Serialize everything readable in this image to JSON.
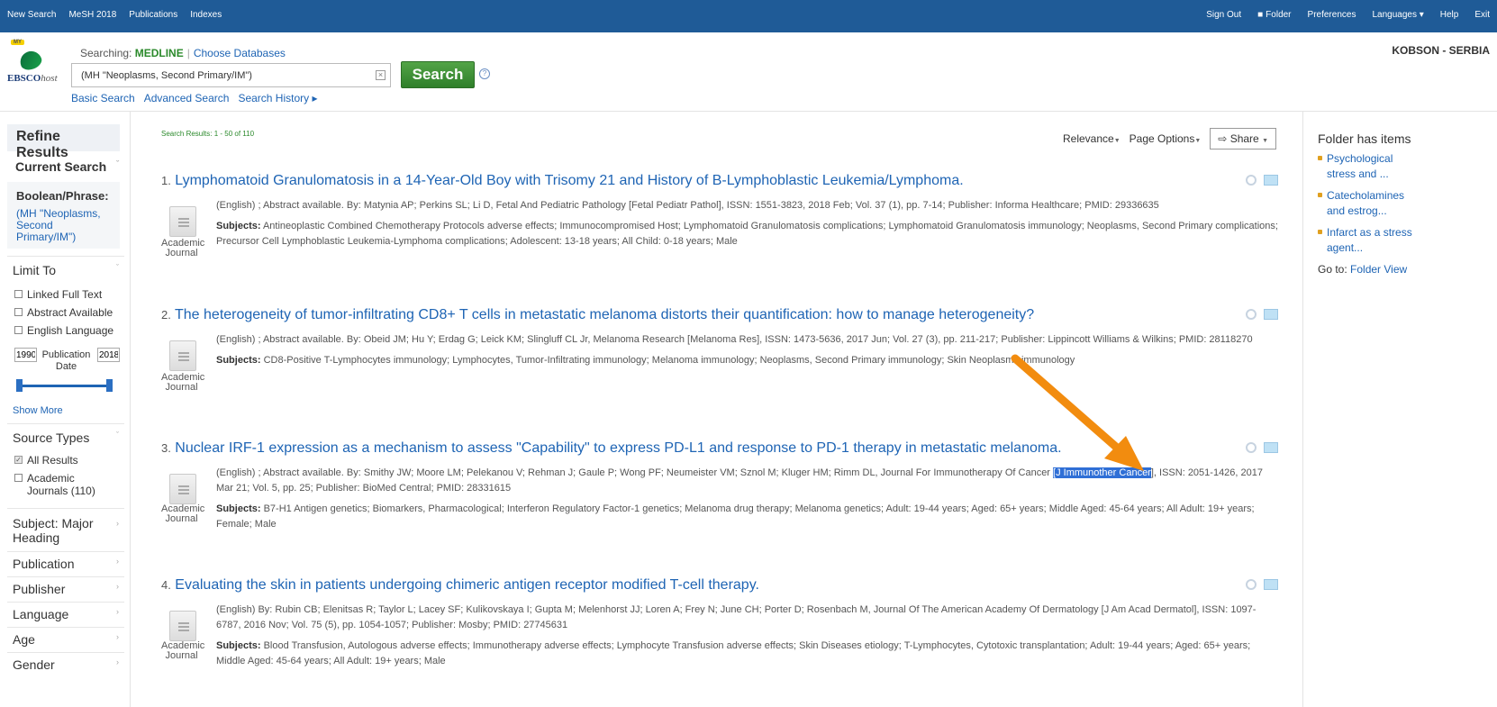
{
  "topnav": {
    "left": [
      "New Search",
      "MeSH 2018",
      "Publications",
      "Indexes"
    ],
    "right": [
      "Sign Out",
      "Folder",
      "Preferences",
      "Languages ▾",
      "Help",
      "Exit"
    ]
  },
  "header": {
    "logo_tag": "MY",
    "logo_brand": "EBSCO",
    "logo_host": "host",
    "searching_label": "Searching:",
    "database": "MEDLINE",
    "choose_databases": "Choose Databases",
    "query": "(MH \"Neoplasms, Second Primary/IM\")",
    "search_button": "Search",
    "links": [
      "Basic Search",
      "Advanced Search",
      "Search History ▸"
    ],
    "organization": "KOBSON - SERBIA"
  },
  "sidebar": {
    "title": "Refine Results",
    "current_search": "Current Search",
    "boolean_label": "Boolean/Phrase:",
    "boolean_value": "(MH \"Neoplasms, Second Primary/IM\")",
    "limit_to": "Limit To",
    "limits": [
      "Linked Full Text",
      "Abstract Available",
      "English Language"
    ],
    "year_from": "1990",
    "year_to": "2018",
    "publication_date": "Publication Date",
    "show_more": "Show More",
    "source_types": "Source Types",
    "source_all": "All Results",
    "source_academic": "Academic Journals (110)",
    "facets": [
      "Subject: Major Heading",
      "Publication",
      "Publisher",
      "Language",
      "Age",
      "Gender"
    ]
  },
  "results": {
    "count": "Search Results: 1 - 50 of 110",
    "sort": "Relevance",
    "page_options": "Page Options",
    "share": "Share",
    "pubtype": "Academic Journal",
    "subjects_label": "Subjects:",
    "items": [
      {
        "num": "1.",
        "title": "Lymphomatoid Granulomatosis in a 14-Year-Old Boy with Trisomy 21 and History of B-Lymphoblastic Leukemia/Lymphoma.",
        "meta": "(English) ; Abstract available. By: Matynia AP; Perkins SL; Li D, Fetal And Pediatric Pathology [Fetal Pediatr Pathol], ISSN: 1551-3823, 2018 Feb; Vol. 37 (1), pp. 7-14; Publisher: Informa Healthcare; PMID: 29336635",
        "subjects": "Antineoplastic Combined Chemotherapy Protocols adverse effects; Immunocompromised Host; Lymphomatoid Granulomatosis complications; Lymphomatoid Granulomatosis immunology; Neoplasms, Second Primary complications; Precursor Cell Lymphoblastic Leukemia-Lymphoma complications; Adolescent: 13-18 years; All Child: 0-18 years; Male"
      },
      {
        "num": "2.",
        "title": "The heterogeneity of tumor-infiltrating CD8+ T cells in metastatic melanoma distorts their quantification: how to manage heterogeneity?",
        "meta": "(English) ; Abstract available. By: Obeid JM; Hu Y; Erdag G; Leick KM; Slingluff CL Jr, Melanoma Research [Melanoma Res], ISSN: 1473-5636, 2017 Jun; Vol. 27 (3), pp. 211-217; Publisher: Lippincott Williams & Wilkins; PMID: 28118270",
        "subjects": "CD8-Positive T-Lymphocytes immunology; Lymphocytes, Tumor-Infiltrating immunology; Melanoma immunology; Neoplasms, Second Primary immunology; Skin Neoplasms immunology"
      },
      {
        "num": "3.",
        "title": "Nuclear IRF-1 expression as a mechanism to assess \"Capability\" to express PD-L1 and response to PD-1 therapy in metastatic melanoma.",
        "meta_before": "(English) ; Abstract available. By: Smithy JW; Moore LM; Pelekanou V; Rehman J; Gaule P; Wong PF; Neumeister VM; Sznol M; Kluger HM; Rimm DL, Journal For Immunotherapy Of Cancer ",
        "meta_highlight": "[J Immunother Cancer",
        "meta_after": "], ISSN: 2051-1426, 2017 Mar 21; Vol. 5, pp. 25; Publisher: BioMed Central; PMID: 28331615",
        "subjects": "B7-H1 Antigen genetics; Biomarkers, Pharmacological; Interferon Regulatory Factor-1 genetics; Melanoma drug therapy; Melanoma genetics; Adult: 19-44 years; Aged: 65+ years; Middle Aged: 45-64 years; All Adult: 19+ years; Female; Male"
      },
      {
        "num": "4.",
        "title": "Evaluating the skin in patients undergoing chimeric antigen receptor modified T-cell therapy.",
        "meta": "(English) By: Rubin CB; Elenitsas R; Taylor L; Lacey SF; Kulikovskaya I; Gupta M; Melenhorst JJ; Loren A; Frey N; June CH; Porter D; Rosenbach M, Journal Of The American Academy Of Dermatology [J Am Acad Dermatol], ISSN: 1097-6787, 2016 Nov; Vol. 75 (5), pp. 1054-1057; Publisher: Mosby; PMID: 27745631",
        "subjects": "Blood Transfusion, Autologous adverse effects; Immunotherapy adverse effects; Lymphocyte Transfusion adverse effects; Skin Diseases etiology; T-Lymphocytes, Cytotoxic transplantation; Adult: 19-44 years; Aged: 65+ years; Middle Aged: 45-64 years; All Adult: 19+ years; Male"
      }
    ]
  },
  "folder": {
    "title": "Folder has items",
    "items": [
      "Psychological stress and ...",
      "Catecholamines and estrog...",
      "Infarct as a stress agent..."
    ],
    "goto_label": "Go to:",
    "goto_link": "Folder View"
  },
  "colors": {
    "topbar": "#1f5b97",
    "link": "#1e64b4",
    "search_button": "#3f8f36",
    "highlight": "#2f6fd6",
    "arrow": "#f28c0f"
  }
}
